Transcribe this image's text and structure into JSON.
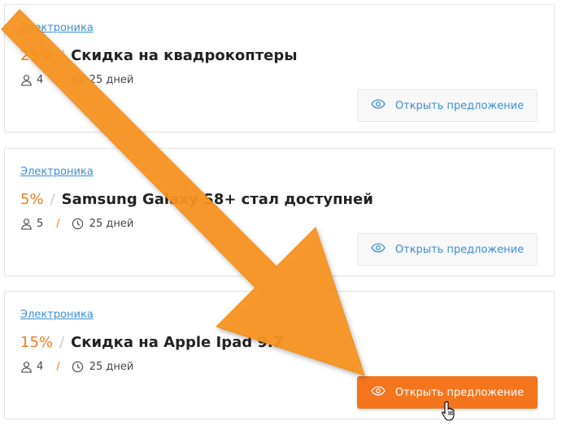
{
  "offers": [
    {
      "category": "Электроника",
      "discount": "25%",
      "slash": "/",
      "title": "Скидка на квадрокоптеры",
      "users": "4",
      "meta_slash": "/",
      "days": "25 дней",
      "button": "Открыть предложение"
    },
    {
      "category": "Электроника",
      "discount": "5%",
      "slash": "/",
      "title": "Samsung Galaxy S8+ стал доступней",
      "users": "5",
      "meta_slash": "/",
      "days": "25 дней",
      "button": "Открыть предложение"
    },
    {
      "category": "Электроника",
      "discount": "15%",
      "slash": "/",
      "title": "Скидка на Apple Ipad 9.7",
      "users": "4",
      "meta_slash": "/",
      "days": "25 дней",
      "button": "Открыть предложение"
    }
  ],
  "icons": {
    "users": "user-icon",
    "time": "clock-icon",
    "view": "eye-icon",
    "pointer": "hand-cursor-icon",
    "overlay": "arrow-icon"
  },
  "colors": {
    "accent": "#f07d1f",
    "link": "#3a8fd6",
    "active_button": "#f4751e",
    "arrow": "#f7931e"
  }
}
